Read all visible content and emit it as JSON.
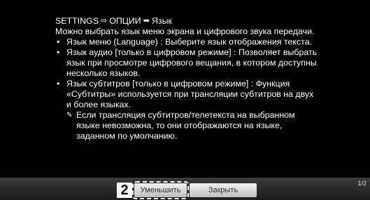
{
  "breadcrumb": {
    "settings": "SETTINGS",
    "options": "ОПЦИИ",
    "language": "Язык",
    "sep1": "⇨",
    "sep2": "➡"
  },
  "intro": "Можно выбрать язык меню экрана и цифрового звука передачи.",
  "bullets": [
    {
      "lines": [
        "Язык меню (Language) : Выберите язык отображения текста."
      ]
    },
    {
      "lines": [
        "Язык аудио [только в цифровом режиме] : Позволяет выбрать",
        "язык при просмотре цифрового вещания, в котором доступны",
        "несколько языков."
      ]
    },
    {
      "lines": [
        "Язык субтитров [только в цифровом режиме] : Функция",
        "«Субтитры» используется при трансляции субтитров на двух",
        "и более языках."
      ]
    }
  ],
  "note": {
    "lines": [
      "Если трансляция субтитров/телетекста на выбранном",
      "языке невозможна, то они отображаются на языке,",
      "заданном по умолчанию."
    ]
  },
  "footer": {
    "page_indicator": "1/2",
    "number_badge": "2",
    "reduce_label": "Уменьшить",
    "close_label": "Закрыть"
  }
}
